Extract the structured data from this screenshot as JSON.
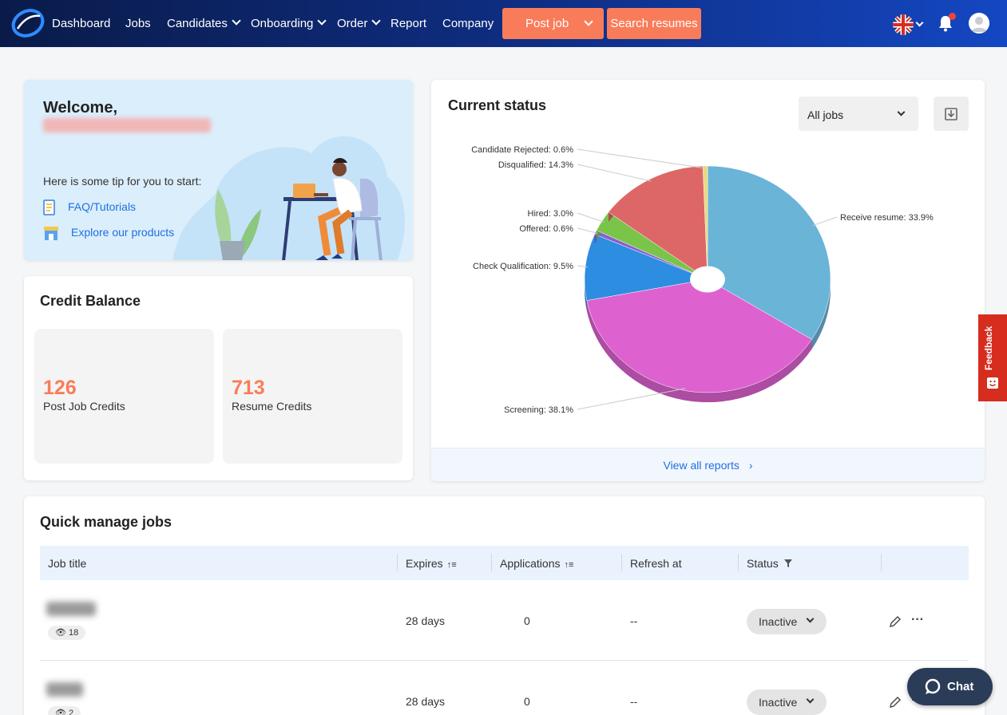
{
  "nav": {
    "items": [
      "Dashboard",
      "Jobs",
      "Candidates",
      "Onboarding",
      "Order",
      "Report",
      "Company"
    ],
    "post_job": "Post job",
    "search_resumes": "Search resumes"
  },
  "welcome": {
    "title": "Welcome,",
    "tip": "Here is some tip for you to start:",
    "faq": "FAQ/Tutorials",
    "explore": "Explore our products"
  },
  "credit": {
    "title": "Credit Balance",
    "post_job_value": "126",
    "post_job_label": "Post Job Credits",
    "resume_value": "713",
    "resume_label": "Resume Credits"
  },
  "status": {
    "title": "Current status",
    "filter": "All jobs",
    "view_all": "View all reports",
    "chart_data": {
      "type": "pie",
      "categories": [
        "Receive resume",
        "Screening",
        "Check Qualification",
        "Offered",
        "Hired",
        "Disqualified",
        "Candidate Rejected"
      ],
      "values": [
        33.9,
        38.1,
        9.5,
        0.6,
        3.0,
        14.3,
        0.6
      ],
      "labels": [
        "Receive resume: 33.9%",
        "Screening: 38.1%",
        "Check Qualification: 9.5%",
        "Offered: 0.6%",
        "Hired: 3.0%",
        "Disqualified: 14.3%",
        "Candidate Rejected: 0.6%"
      ],
      "colors": [
        "#6ab4d8",
        "#dd62d0",
        "#2d8de0",
        "#8a5fd0",
        "#7ac44a",
        "#dd6767",
        "#e8d97a"
      ]
    }
  },
  "quick": {
    "title": "Quick manage jobs",
    "columns": [
      "Job title",
      "Expires",
      "Applications",
      "Refresh at",
      "Status"
    ],
    "rows": [
      {
        "views": "18",
        "expires": "28 days",
        "applications": "0",
        "refresh": "--",
        "status": "Inactive"
      },
      {
        "views": "2",
        "expires": "28 days",
        "applications": "0",
        "refresh": "--",
        "status": "Inactive"
      }
    ]
  },
  "feedback": "Feedback",
  "chat": "Chat"
}
